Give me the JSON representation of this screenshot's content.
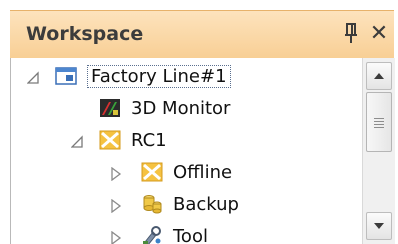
{
  "panel": {
    "title": "Workspace",
    "pin_icon": "pin-icon",
    "close_glyph": "✕"
  },
  "tree": {
    "items": [
      {
        "label": "Factory Line#1",
        "icon": "workspace-window-icon",
        "expander": "expanded",
        "selected": true
      },
      {
        "label": "3D Monitor",
        "icon": "3d-monitor-icon",
        "expander": "none",
        "selected": false
      },
      {
        "label": "RC1",
        "icon": "robot-controller-icon",
        "expander": "expanded",
        "selected": false
      },
      {
        "label": "Offline",
        "icon": "offline-icon",
        "expander": "collapsed",
        "selected": false
      },
      {
        "label": "Backup",
        "icon": "backup-database-icon",
        "expander": "collapsed",
        "selected": false
      },
      {
        "label": "Tool",
        "icon": "tool-icon",
        "expander": "collapsed",
        "selected": false
      }
    ]
  },
  "scrollbar": {
    "up_icon": "scroll-up-arrow-icon",
    "down_icon": "scroll-down-arrow-icon"
  },
  "colors": {
    "title_bar_top": "#fde3bd",
    "title_bar_bottom": "#f8cf95",
    "selection_border": "#5a6f8f"
  }
}
